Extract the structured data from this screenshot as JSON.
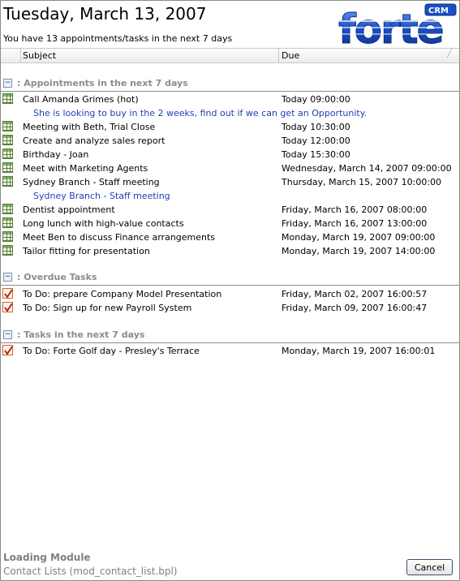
{
  "header": {
    "date_title": "Tuesday, March 13, 2007",
    "subtitle": "You have 13 appointments/tasks in the next 7 days",
    "logo_text": "forte",
    "logo_badge": "CRM"
  },
  "columns": {
    "subject": "Subject",
    "due": "Due"
  },
  "groups": {
    "appointments": {
      "label": ": Appointments in the next 7 days",
      "toggle": "−",
      "items": [
        {
          "subject": "Call Amanda Grimes (hot)",
          "due": "Today 09:00:00"
        },
        {
          "subject": "Meeting with Beth, Trial Close",
          "due": "Today 10:30:00"
        },
        {
          "subject": "Create and analyze sales report",
          "due": "Today 12:00:00"
        },
        {
          "subject": "Birthday - Joan",
          "due": "Today 15:30:00"
        },
        {
          "subject": "Meet with Marketing Agents",
          "due": "Wednesday, March 14, 2007 09:00:00"
        },
        {
          "subject": "Sydney Branch - Staff meeting",
          "due": "Thursday, March 15, 2007 10:00:00"
        },
        {
          "subject": "Dentist appointment",
          "due": "Friday, March 16, 2007 08:00:00"
        },
        {
          "subject": "Long lunch with high-value contacts",
          "due": "Friday, March 16, 2007 13:00:00"
        },
        {
          "subject": "Meet Ben to discuss Finance arrangements",
          "due": "Monday, March 19, 2007 09:00:00"
        },
        {
          "subject": "Tailor fitting for presentation",
          "due": "Monday, March 19, 2007 14:00:00"
        }
      ],
      "notes": {
        "amanda": "She is looking to buy in the 2 weeks, find out if we can get an Opportunity.",
        "sydney": "Sydney Branch - Staff meeting"
      }
    },
    "overdue": {
      "label": ": Overdue Tasks",
      "toggle": "−",
      "items": [
        {
          "subject": "To Do: prepare Company Model Presentation",
          "due": "Friday, March 02, 2007 16:00:57"
        },
        {
          "subject": "To Do: Sign up for new Payroll System",
          "due": "Friday, March 09, 2007 16:00:47"
        }
      ]
    },
    "tasks": {
      "label": ": Tasks in the next 7 days",
      "toggle": "−",
      "items": [
        {
          "subject": "To Do: Forte Golf day - Presley's Terrace",
          "due": "Monday, March 19, 2007 16:00:01"
        }
      ]
    }
  },
  "footer": {
    "loading": "Loading Module",
    "module": "Contact Lists (mod_contact_list.bpl)",
    "cancel_label": "Cancel"
  },
  "colors": {
    "note_text": "#1f3fb8",
    "group_text": "#8c8c8c",
    "logo_blue": "#1a4fc4"
  }
}
